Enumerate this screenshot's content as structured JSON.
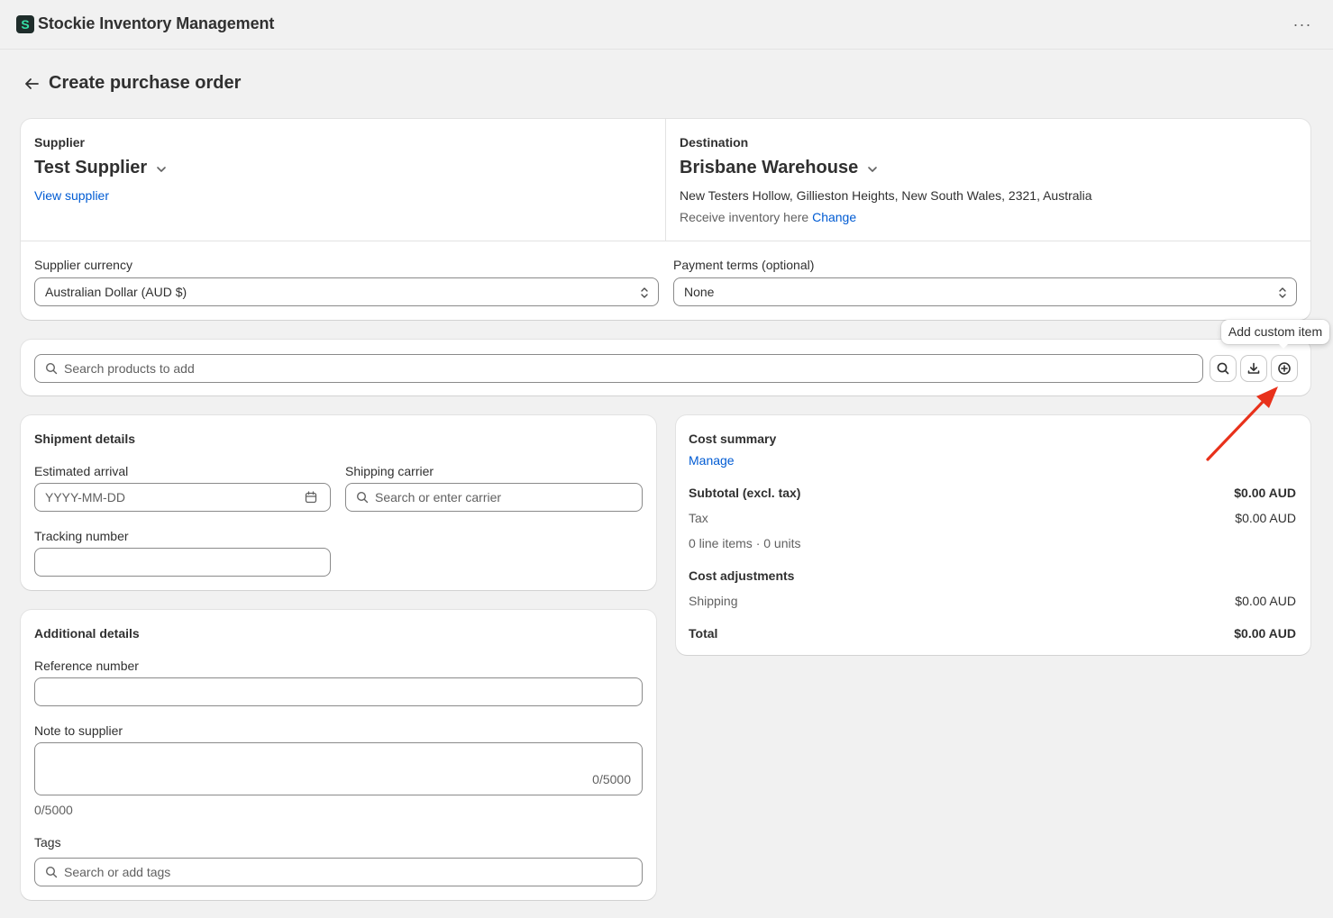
{
  "app": {
    "title": "Stockie Inventory Management",
    "logo_letter": "S",
    "more_label": "···"
  },
  "page": {
    "title": "Create purchase order"
  },
  "supplier": {
    "label": "Supplier",
    "name": "Test Supplier",
    "view_link": "View supplier"
  },
  "destination": {
    "label": "Destination",
    "name": "Brisbane Warehouse",
    "address": "New Testers Hollow, Gillieston Heights, New South Wales, 2321, Australia",
    "receive_text": "Receive inventory here",
    "change_link": "Change"
  },
  "currency": {
    "label": "Supplier currency",
    "value": "Australian Dollar (AUD $)"
  },
  "payment_terms": {
    "label": "Payment terms (optional)",
    "value": "None"
  },
  "product_search": {
    "placeholder": "Search products to add",
    "tooltip": "Add custom item"
  },
  "shipment": {
    "title": "Shipment details",
    "arrival_label": "Estimated arrival",
    "arrival_placeholder": "YYYY-MM-DD",
    "carrier_label": "Shipping carrier",
    "carrier_placeholder": "Search or enter carrier",
    "tracking_label": "Tracking number",
    "tracking_value": ""
  },
  "additional": {
    "title": "Additional details",
    "reference_label": "Reference number",
    "reference_value": "",
    "note_label": "Note to supplier",
    "note_counter_inner": "0/5000",
    "note_counter_outer": "0/5000",
    "tags_label": "Tags",
    "tags_placeholder": "Search or add tags"
  },
  "cost_summary": {
    "title": "Cost summary",
    "manage_link": "Manage",
    "subtotal_label": "Subtotal (excl. tax)",
    "subtotal_value": "$0.00 AUD",
    "tax_label": "Tax",
    "tax_value": "$0.00 AUD",
    "items_text": "0 line items · 0 units",
    "adjustments_title": "Cost adjustments",
    "shipping_label": "Shipping",
    "shipping_value": "$0.00 AUD",
    "total_label": "Total",
    "total_value": "$0.00 AUD"
  },
  "colors": {
    "link": "#005bd3",
    "annotation_arrow": "#e8311b",
    "logo_bg": "#1f2d2b",
    "logo_fg": "#35e0a8"
  }
}
